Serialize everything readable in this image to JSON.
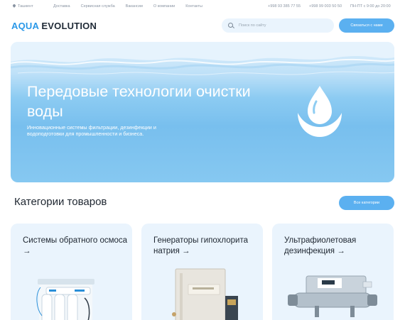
{
  "topbar": {
    "city": "Ташкент",
    "nav": [
      "Доставка",
      "Сервисная служба",
      "Вакансии",
      "О компании",
      "Контакты"
    ],
    "phones": [
      "+998 93 385 77 55",
      "+998 99 003 50 50"
    ],
    "hours": "ПН-ПТ с 9:00 до 20:00"
  },
  "header": {
    "logo_part1": "AQUA",
    "logo_part2": "EVOLUTION",
    "search_placeholder": "Поиск по сайту",
    "contact_button": "Связаться с нами"
  },
  "hero": {
    "title": "Передовые технологии очистки воды",
    "subtitle": "Инновационные системы фильтрации, дезинфекции и водоподготовки для промышленности и бизнеса."
  },
  "categories": {
    "title": "Категории товаров",
    "all_button": "Все категории",
    "items": [
      {
        "label": "Системы обратного осмоса",
        "arrow": "→"
      },
      {
        "label": "Генераторы гипохлорита натрия",
        "arrow": "→"
      },
      {
        "label": "Ультрафиолетовая дезинфекция",
        "arrow": "→"
      }
    ]
  },
  "colors": {
    "accent": "#5bb0f0",
    "logo_blue": "#2a98e8",
    "card_bg": "#eaf4fd"
  },
  "icons": [
    "location-pin-icon",
    "search-icon",
    "water-drop-icon",
    "arrow-right-icon"
  ]
}
